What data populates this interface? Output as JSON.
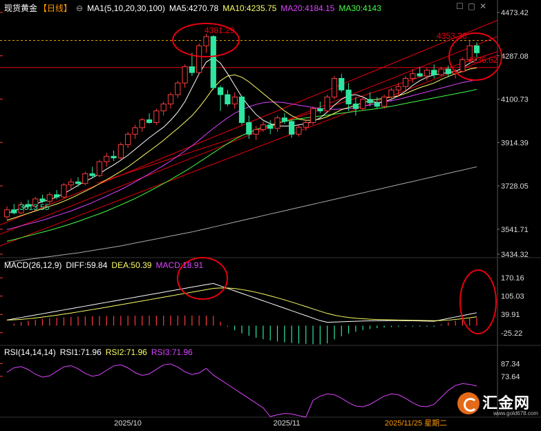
{
  "header": {
    "symbol": "现货黄金",
    "period": "【日线】",
    "ma_label": "MA1(5,10,20,30,100)",
    "ma5": "MA5:4270.78",
    "ma10": "MA10:4235.75",
    "ma20": "MA20:4184.15",
    "ma30": "MA30:4143"
  },
  "macd_header": {
    "label": "MACD(26,12,9)",
    "diff": "DIFF:59.84",
    "dea": "DEA:50.39",
    "macd": "MACD:18.91"
  },
  "rsi_header": {
    "label": "RSI(14,14,14)",
    "rsi1": "RSI1:71.96",
    "rsi2": "RSI2:71.96",
    "rsi3": "RSI3:71.96"
  },
  "watermark": {
    "name": "汇金网",
    "url": "www.gold678.com"
  },
  "colors": {
    "up": "#ff3b3b",
    "down": "#2ee6a0",
    "ma5": "#ffffff",
    "ma10": "#ffff66",
    "ma20": "#dd44ff",
    "ma30": "#44ff44",
    "ma100": "#aaaaaa",
    "annotation": "#e8000e"
  },
  "chart_data": [
    {
      "type": "candlestick",
      "panel": "price",
      "y_ticks": [
        4473.42,
        4287.08,
        4100.73,
        3914.39,
        3728.05,
        3541.71,
        3434.32
      ],
      "ylim": [
        3434.32,
        4473.42
      ],
      "x_labels": [
        "2025/10",
        "2025/11",
        "2025/11/25 星期二"
      ],
      "annotations": [
        "4381.29",
        "4353.36",
        "4236.62",
        "3613.55"
      ],
      "candles_note": "approximate daily OHLC read from chart",
      "ohlc": [
        [
          3595,
          3640,
          3585,
          3625
        ],
        [
          3625,
          3650,
          3605,
          3612
        ],
        [
          3612,
          3660,
          3608,
          3648
        ],
        [
          3648,
          3668,
          3630,
          3640
        ],
        [
          3640,
          3680,
          3632,
          3672
        ],
        [
          3672,
          3690,
          3655,
          3662
        ],
        [
          3662,
          3700,
          3650,
          3690
        ],
        [
          3690,
          3710,
          3670,
          3680
        ],
        [
          3680,
          3740,
          3675,
          3732
        ],
        [
          3732,
          3760,
          3715,
          3745
        ],
        [
          3745,
          3765,
          3725,
          3738
        ],
        [
          3738,
          3790,
          3730,
          3780
        ],
        [
          3780,
          3810,
          3760,
          3772
        ],
        [
          3772,
          3840,
          3765,
          3832
        ],
        [
          3832,
          3870,
          3810,
          3855
        ],
        [
          3855,
          3880,
          3835,
          3848
        ],
        [
          3848,
          3915,
          3842,
          3905
        ],
        [
          3905,
          3960,
          3890,
          3950
        ],
        [
          3950,
          3990,
          3930,
          3978
        ],
        [
          3978,
          4020,
          3960,
          4012
        ],
        [
          4012,
          4040,
          3995,
          4000
        ],
        [
          4000,
          4060,
          3990,
          4050
        ],
        [
          4050,
          4090,
          4030,
          4080
        ],
        [
          4080,
          4130,
          4060,
          4120
        ],
        [
          4120,
          4180,
          4105,
          4170
        ],
        [
          4170,
          4250,
          4150,
          4240
        ],
        [
          4240,
          4300,
          4200,
          4215
        ],
        [
          4215,
          4340,
          4210,
          4330
        ],
        [
          4330,
          4381.29,
          4300,
          4370
        ],
        [
          4370,
          4375,
          4140,
          4150
        ],
        [
          4150,
          4160,
          4050,
          4120
        ],
        [
          4120,
          4140,
          4070,
          4080
        ],
        [
          4080,
          4130,
          4060,
          4110
        ],
        [
          4110,
          4115,
          3990,
          4000
        ],
        [
          4000,
          4030,
          3930,
          3950
        ],
        [
          3950,
          3985,
          3925,
          3970
        ],
        [
          3970,
          4005,
          3960,
          3990
        ],
        [
          3990,
          4010,
          3950,
          3975
        ],
        [
          3975,
          4030,
          3960,
          4020
        ],
        [
          4020,
          4040,
          3995,
          4005
        ],
        [
          4005,
          4010,
          3935,
          3950
        ],
        [
          3950,
          3990,
          3940,
          3980
        ],
        [
          3980,
          4010,
          3965,
          4000
        ],
        [
          4000,
          4070,
          3990,
          4060
        ],
        [
          4060,
          4090,
          4040,
          4050
        ],
        [
          4050,
          4120,
          4040,
          4110
        ],
        [
          4110,
          4200,
          4100,
          4190
        ],
        [
          4190,
          4210,
          4130,
          4140
        ],
        [
          4140,
          4170,
          4050,
          4080
        ],
        [
          4080,
          4110,
          4030,
          4060
        ],
        [
          4060,
          4110,
          4050,
          4100
        ],
        [
          4100,
          4130,
          4070,
          4085
        ],
        [
          4085,
          4110,
          4060,
          4070
        ],
        [
          4070,
          4120,
          4060,
          4110
        ],
        [
          4110,
          4150,
          4090,
          4140
        ],
        [
          4140,
          4170,
          4110,
          4155
        ],
        [
          4155,
          4200,
          4140,
          4190
        ],
        [
          4190,
          4230,
          4170,
          4210
        ],
        [
          4210,
          4240,
          4195,
          4200
        ],
        [
          4200,
          4235,
          4180,
          4225
        ],
        [
          4225,
          4250,
          4190,
          4205
        ],
        [
          4205,
          4240,
          4200,
          4230
        ],
        [
          4230,
          4245,
          4195,
          4210
        ],
        [
          4210,
          4230,
          4190,
          4220
        ],
        [
          4220,
          4280,
          4215,
          4270
        ],
        [
          4270,
          4353.36,
          4260,
          4330
        ],
        [
          4330,
          4345,
          4280,
          4300
        ]
      ],
      "ma5": [
        3610,
        3620,
        3632,
        3640,
        3650,
        3660,
        3668,
        3680,
        3695,
        3712,
        3730,
        3748,
        3762,
        3780,
        3800,
        3818,
        3838,
        3860,
        3885,
        3910,
        3935,
        3958,
        3980,
        4010,
        4045,
        4090,
        4150,
        4210,
        4260,
        4280,
        4255,
        4210,
        4160,
        4110,
        4070,
        4035,
        4010,
        3995,
        3985,
        3985,
        3985,
        3990,
        3995,
        4005,
        4020,
        4045,
        4075,
        4100,
        4115,
        4120,
        4110,
        4095,
        4085,
        4090,
        4100,
        4115,
        4135,
        4160,
        4180,
        4195,
        4205,
        4210,
        4215,
        4220,
        4235,
        4255,
        4270.78
      ],
      "ma10": [
        3580,
        3590,
        3600,
        3610,
        3620,
        3630,
        3640,
        3650,
        3662,
        3675,
        3690,
        3705,
        3720,
        3737,
        3754,
        3772,
        3790,
        3810,
        3832,
        3855,
        3878,
        3900,
        3924,
        3950,
        3975,
        4002,
        4030,
        4065,
        4105,
        4148,
        4180,
        4200,
        4205,
        4195,
        4175,
        4150,
        4125,
        4100,
        4075,
        4050,
        4030,
        4015,
        4010,
        4010,
        4015,
        4025,
        4040,
        4055,
        4065,
        4075,
        4085,
        4095,
        4100,
        4105,
        4110,
        4115,
        4125,
        4138,
        4150,
        4160,
        4170,
        4185,
        4198,
        4210,
        4220,
        4230,
        4235.75
      ],
      "ma20": [
        3540,
        3548,
        3556,
        3564,
        3572,
        3580,
        3590,
        3600,
        3610,
        3620,
        3632,
        3644,
        3656,
        3670,
        3684,
        3698,
        3712,
        3728,
        3745,
        3762,
        3780,
        3798,
        3816,
        3835,
        3856,
        3878,
        3900,
        3925,
        3950,
        3975,
        3998,
        4020,
        4040,
        4055,
        4068,
        4078,
        4085,
        4088,
        4088,
        4085,
        4080,
        4075,
        4070,
        4065,
        4060,
        4058,
        4057,
        4058,
        4060,
        4064,
        4070,
        4076,
        4082,
        4088,
        4094,
        4100,
        4108,
        4116,
        4124,
        4132,
        4140,
        4148,
        4156,
        4164,
        4172,
        4178,
        4184.15
      ],
      "ma30": [
        3490,
        3497,
        3505,
        3513,
        3521,
        3529,
        3537,
        3546,
        3555,
        3565,
        3575,
        3586,
        3597,
        3608,
        3620,
        3633,
        3646,
        3660,
        3674,
        3689,
        3705,
        3721,
        3738,
        3755,
        3773,
        3791,
        3810,
        3830,
        3850,
        3870,
        3890,
        3910,
        3928,
        3944,
        3958,
        3970,
        3981,
        3990,
        3998,
        4005,
        4011,
        4016,
        4020,
        4024,
        4028,
        4032,
        4036,
        4040,
        4044,
        4048,
        4052,
        4056,
        4060,
        4065,
        4070,
        4076,
        4082,
        4088,
        4094,
        4100,
        4106,
        4112,
        4118,
        4124,
        4130,
        4136,
        4143
      ],
      "ma100": [
        3400,
        3404,
        3408,
        3412,
        3416,
        3420,
        3424,
        3428,
        3432,
        3436,
        3440,
        3445,
        3450,
        3455,
        3460,
        3465,
        3470,
        3476,
        3482,
        3488,
        3494,
        3500,
        3506,
        3512,
        3518,
        3524,
        3530,
        3537,
        3544,
        3551,
        3558,
        3565,
        3572,
        3579,
        3586,
        3593,
        3600,
        3607,
        3614,
        3621,
        3628,
        3635,
        3642,
        3649,
        3656,
        3663,
        3670,
        3677,
        3684,
        3691,
        3698,
        3705,
        3712,
        3719,
        3726,
        3733,
        3740,
        3747,
        3754,
        3761,
        3768,
        3775,
        3782,
        3789,
        3796,
        3803,
        3810
      ]
    },
    {
      "type": "macd",
      "panel": "macd",
      "y_ticks": [
        170.16,
        105.03,
        39.91,
        -25.22
      ],
      "ylim": [
        -65,
        200
      ],
      "diff_end": 59.84,
      "dea_end": 50.39,
      "macd_end": 18.91
    },
    {
      "type": "line",
      "panel": "rsi",
      "y_ticks": [
        87.34,
        73.64
      ],
      "ylim": [
        30,
        95
      ],
      "rsi_end": 71.96
    }
  ]
}
